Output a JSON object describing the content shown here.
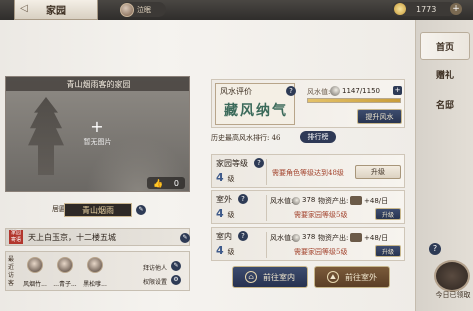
{
  "topbar": {
    "title": "家园",
    "user_name": "泣眠",
    "currency_value": "1773"
  },
  "nav": {
    "items": [
      {
        "label": "首页",
        "active": true
      },
      {
        "label": "赠礼",
        "active": false
      },
      {
        "label": "名邸",
        "active": false
      }
    ],
    "daily_reward_label": "今日已领取"
  },
  "home": {
    "card_title": "青山烟雨客的家园",
    "no_photo": "暂无图片",
    "likes": "0",
    "name_label": "居匾",
    "name": "青山烟雨",
    "seal_text": "家园寄语",
    "motto": "天上白玉京，十二楼五城",
    "visitors_label": "最近访客",
    "visitors": [
      {
        "name": "风烟竹..."
      },
      {
        "name": "...青子..."
      },
      {
        "name": "黑松嗲..."
      }
    ],
    "visitor_actions": [
      "拜访他人",
      "权限设置"
    ]
  },
  "fengshui": {
    "title": "风水评价",
    "calligraphy": "藏风纳气",
    "value_label": "风水值:",
    "value": "1147/1150",
    "progress": 0.997,
    "upgrade_label": "提升风水",
    "rank_text": "历史最高风水排行: 46",
    "rank_button": "排行榜"
  },
  "level_card": {
    "title": "家园等级",
    "level": "4",
    "level_unit": "级",
    "requirement": "需要角色等级达到48级",
    "upgrade_label": "升级"
  },
  "outdoor_card": {
    "title": "室外",
    "level": "4",
    "level_unit": "级",
    "fs_label": "风水值:",
    "fs_value": "378",
    "prod_label": "物资产出:",
    "prod_value": "+48/日",
    "requirement": "需要家园等级5级",
    "upgrade_label": "升级"
  },
  "indoor_card": {
    "title": "室内",
    "level": "4",
    "level_unit": "级",
    "fs_label": "风水值:",
    "fs_value": "378",
    "prod_label": "物资产出:",
    "prod_value": "+48/日",
    "requirement": "需要家园等级5级",
    "upgrade_label": "升级"
  },
  "actions": {
    "go_indoor": "前往室内",
    "go_outdoor": "前往室外"
  },
  "colors": {
    "accent_dark": "#2d3a55",
    "calligraphy": "#3b6a5a",
    "warning": "#a2422c"
  }
}
